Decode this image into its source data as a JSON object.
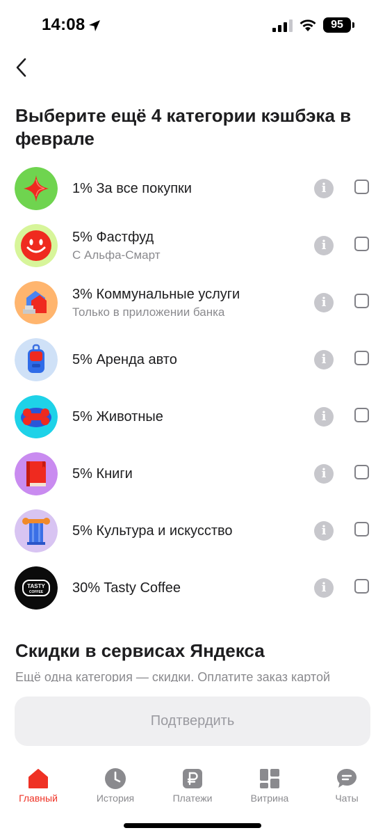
{
  "status_bar": {
    "time": "14:08",
    "battery": "95"
  },
  "header": {
    "title": "Выберите ещё 4 категории кэшбэка в феврале"
  },
  "categories": [
    {
      "title": "1% За все покупки",
      "subtitle": "",
      "icon": "red-star-icon"
    },
    {
      "title": "5% Фастфуд",
      "subtitle": "С Альфа-Смарт",
      "icon": "smiley-face-icon"
    },
    {
      "title": "3% Коммунальные услуги",
      "subtitle": "Только в приложении банка",
      "icon": "house-icon"
    },
    {
      "title": "5% Аренда авто",
      "subtitle": "",
      "icon": "car-key-icon"
    },
    {
      "title": "5% Животные",
      "subtitle": "",
      "icon": "dog-bone-icon"
    },
    {
      "title": "5% Книги",
      "subtitle": "",
      "icon": "book-icon"
    },
    {
      "title": "5% Культура и искусство",
      "subtitle": "",
      "icon": "column-icon"
    },
    {
      "title": "30% Tasty Coffee",
      "subtitle": "",
      "icon": "tasty-coffee-logo"
    }
  ],
  "info_glyph": "i",
  "yandex_section": {
    "title": "Скидки в сервисах Яндекса",
    "text": "Ещё одна категория — скидки. Оплатите заказ картой"
  },
  "confirm_button": "Подтвердить",
  "tabs": [
    {
      "label": "Главный",
      "icon": "home-icon",
      "active": true
    },
    {
      "label": "История",
      "icon": "clock-icon",
      "active": false
    },
    {
      "label": "Платежи",
      "icon": "ruble-icon",
      "active": false
    },
    {
      "label": "Витрина",
      "icon": "grid-icon",
      "active": false
    },
    {
      "label": "Чаты",
      "icon": "chat-icon",
      "active": false
    }
  ],
  "colors": {
    "accent": "#ef3124",
    "inactive": "#8a8a8e",
    "button_bg": "#efeff1"
  }
}
